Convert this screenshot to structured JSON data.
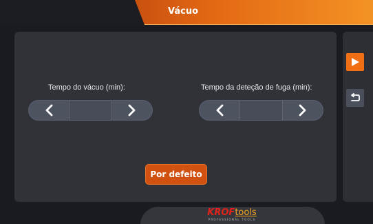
{
  "header": {
    "title": "Vácuo"
  },
  "vacuum_time": {
    "label": "Tempo do vácuo (min):",
    "value": "",
    "decrease_symbol": "chevron-left-icon",
    "increase_symbol": "chevron-right-icon"
  },
  "leak_detection_time": {
    "label": "Tempo da deteção de fuga (min):",
    "value": "",
    "decrease_symbol": "chevron-left-icon",
    "increase_symbol": "chevron-right-icon"
  },
  "default_button": {
    "label": "Por defeito"
  },
  "side_controls": {
    "start_icon": "play-icon",
    "back_icon": "return-arrow-icon"
  },
  "footer": {
    "logo_brand": "KROF",
    "logo_suffix": "tools",
    "logo_tagline": "PROFESSIONAL TOOLS"
  },
  "colors": {
    "accent": "#e46a14",
    "button": "#d15210",
    "panel": "#303238",
    "background": "#191b20",
    "stepper": "#4e5360"
  }
}
